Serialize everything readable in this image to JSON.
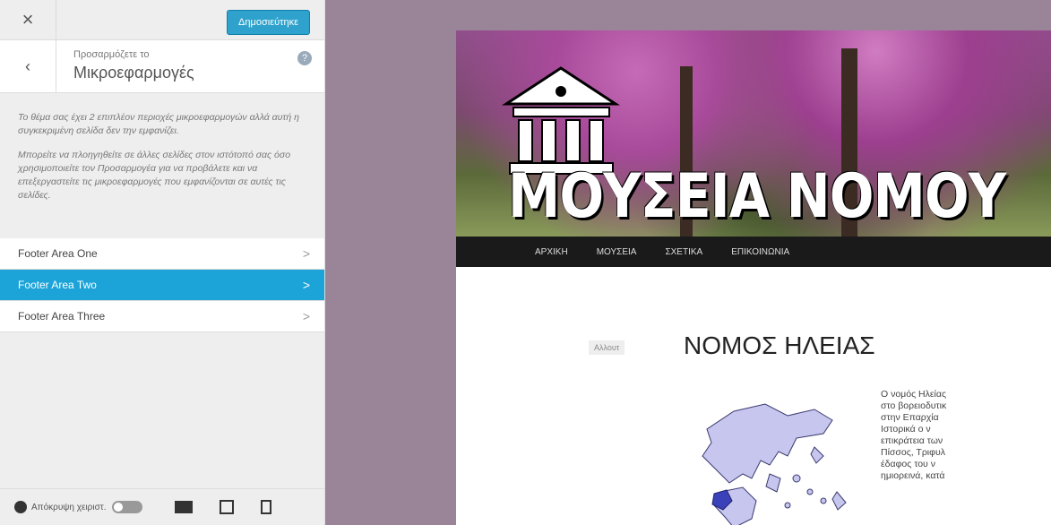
{
  "customizer": {
    "close_label": "×",
    "publish_label": "Δημοσιεύτηκε",
    "customizing_label": "Προσαρμόζετε το",
    "section_title": "Μικροεφαρμογές",
    "back_label": "‹",
    "help_label": "?",
    "description": [
      "Το θέμα σας έχει 2 επιπλέον περιοχές μικροεφαρμογών αλλά αυτή η συγκεκριμένη σελίδα δεν την εμφανίζει.",
      "Μπορείτε να πλοηγηθείτε σε άλλες σελίδες στον ιστότοπό σας όσο χρησιμοποιείτε τον Προσαρμογέα για να προβάλετε και να επεξεργαστείτε τις μικροεφαρμογές που εμφανίζονται σε αυτές τις σελίδες."
    ],
    "areas": [
      {
        "label": "Footer Area One",
        "chev": ">"
      },
      {
        "label": "Footer Area Two",
        "chev": ">"
      },
      {
        "label": "Footer Area Three",
        "chev": ">"
      }
    ],
    "hide_controls_label": "Απόκρυψη χειριστ."
  },
  "preview": {
    "site_title": "ΜΟΥΣΕΙΑ ΝΟΜΟΥ",
    "nav": [
      "ΑΡΧΙΚΗ",
      "ΜΟΥΣΕΙΑ",
      "ΣΧΕΤΙΚΑ",
      "ΕΠΙΚΟΙΝΩΝΙΑ"
    ],
    "category": "Αλλουτ",
    "post_title": "ΝΟΜΟΣ ΗΛΕΙΑΣ",
    "body_lines": [
      "Ο νομός Ηλείας",
      "στο βορειοδυτικ",
      "στην Επαρχία",
      "Ιστορικά ο ν",
      "επικράτεια των",
      "Πίσσος, Τριφυλ",
      "έδαφος του ν",
      "ημιορεινά, κατά"
    ]
  },
  "colors": {
    "accent": "#1ca4d8",
    "publish": "#2ea2cc",
    "preview_bg": "#9a8498",
    "nav_bg": "#1a1a1a"
  }
}
